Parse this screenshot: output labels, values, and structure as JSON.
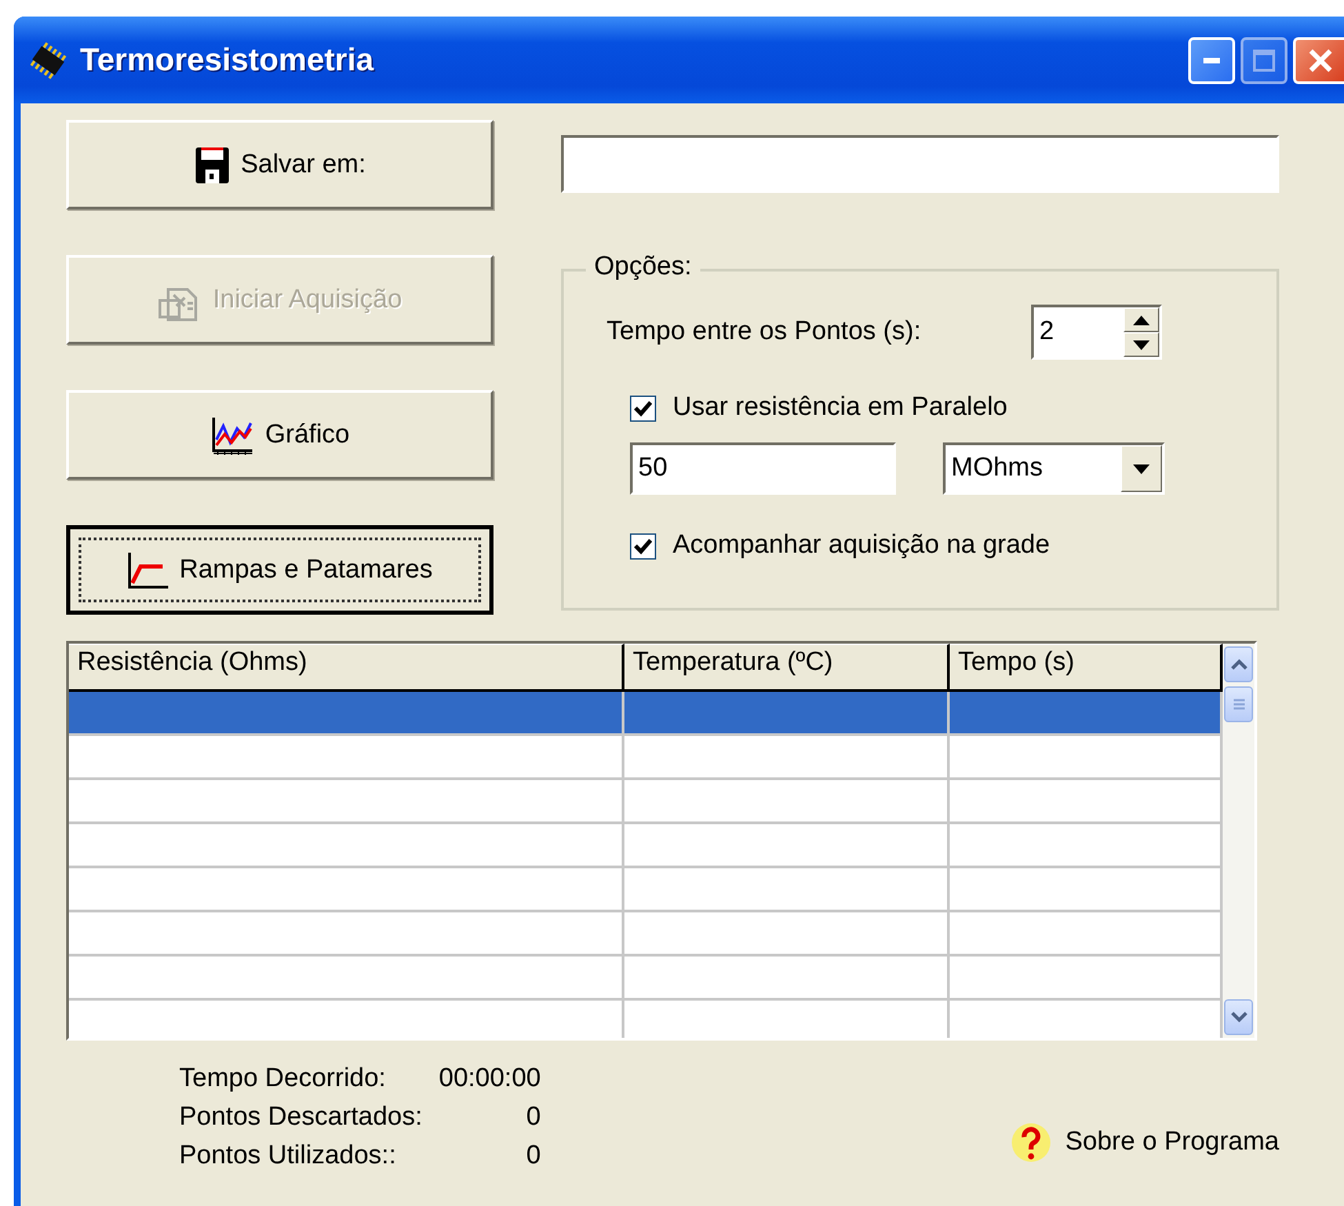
{
  "window": {
    "title": "Termoresistometria"
  },
  "buttons": [
    {
      "kind": "save",
      "label": "Salvar em:",
      "disabled": false,
      "focused": false
    },
    {
      "kind": "acquire",
      "label": "Iniciar Aquisição",
      "disabled": true,
      "focused": false
    },
    {
      "kind": "chart",
      "label": "Gráfico",
      "disabled": false,
      "focused": false
    },
    {
      "kind": "ramp",
      "label": "Rampas e Patamares",
      "disabled": false,
      "focused": true
    }
  ],
  "options": {
    "title": "Opções:",
    "interval_label": "Tempo entre os Pontos (s):",
    "interval_value": "2",
    "parallel": {
      "label": "Usar resistência em Paralelo",
      "checked": true
    },
    "resistance_value": "50",
    "unit": "MOhms",
    "follow": {
      "label": "Acompanhar aquisição na grade",
      "checked": true
    }
  },
  "table": {
    "columns": [
      "Resistência (Ohms)",
      "Temperatura (ºC)",
      "Tempo (s)"
    ],
    "rows": [
      {
        "selected": true
      },
      {
        "selected": false
      },
      {
        "selected": false
      },
      {
        "selected": false
      },
      {
        "selected": false
      },
      {
        "selected": false
      },
      {
        "selected": false
      },
      {
        "selected": false
      }
    ]
  },
  "stats": [
    {
      "label": "Tempo Decorrido:",
      "value": "00:00:00"
    },
    {
      "label": "Pontos Descartados:",
      "value": "0"
    },
    {
      "label": "Pontos Utilizados::",
      "value": "0"
    }
  ],
  "about_link": "Sobre o Programa"
}
